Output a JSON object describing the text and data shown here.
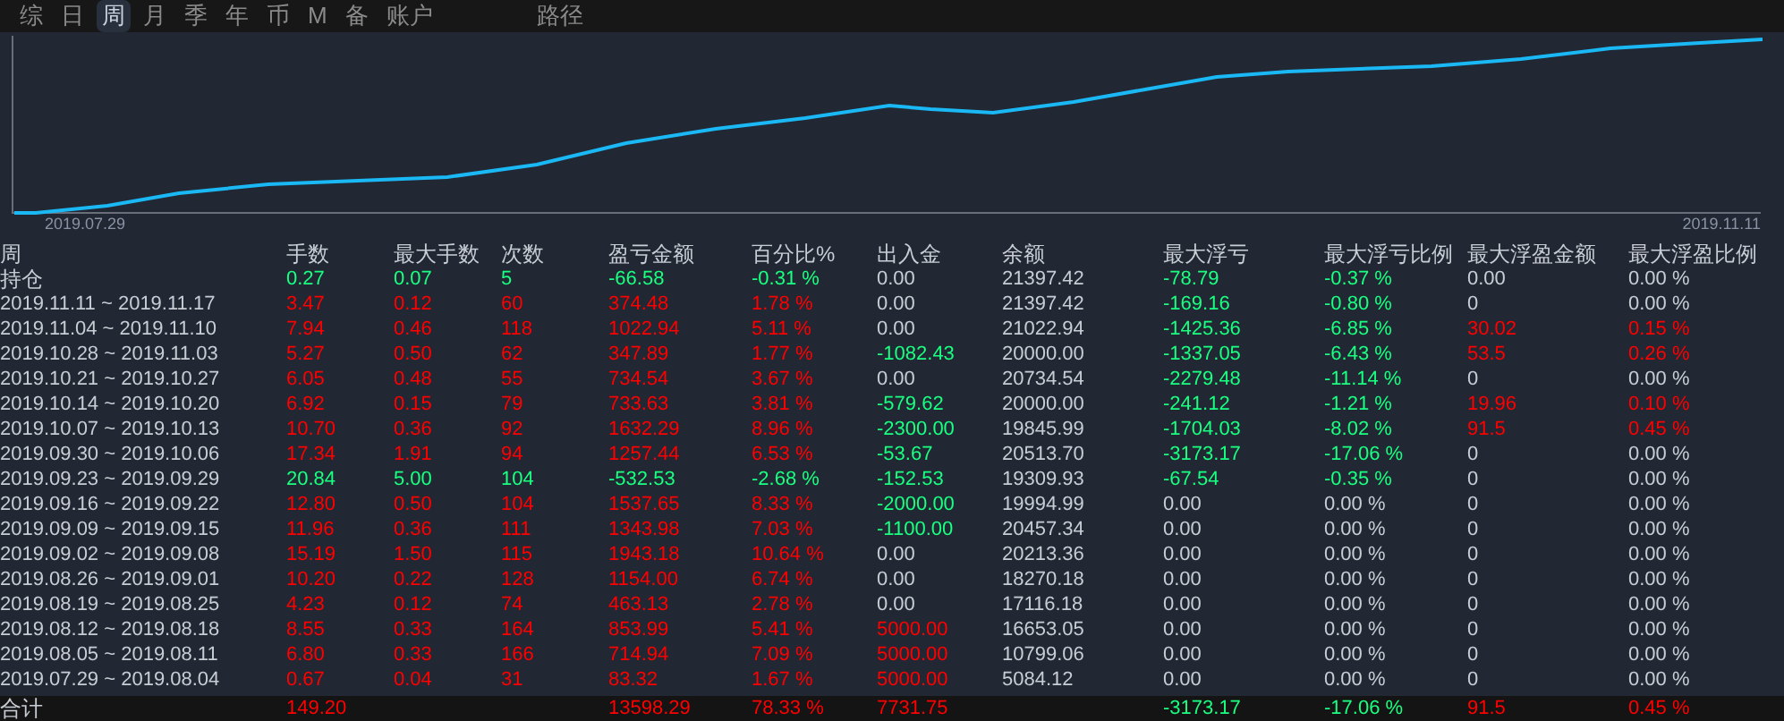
{
  "tabs": [
    {
      "label": "综",
      "selected": false
    },
    {
      "label": "日",
      "selected": false
    },
    {
      "label": "周",
      "selected": true
    },
    {
      "label": "月",
      "selected": false
    },
    {
      "label": "季",
      "selected": false
    },
    {
      "label": "年",
      "selected": false
    },
    {
      "label": "币",
      "selected": false
    },
    {
      "label": "M",
      "selected": false
    },
    {
      "label": "备",
      "selected": false
    },
    {
      "label": "账户",
      "selected": false
    }
  ],
  "right_tabs": [
    {
      "label": "路径",
      "selected": false
    }
  ],
  "chart": {
    "x_start": "2019.07.29",
    "x_end": "2019.11.11"
  },
  "table": {
    "label_header": "周",
    "columns": [
      "手数",
      "最大手数",
      "次数",
      "盈亏金额",
      "百分比%",
      "出入金",
      "余额",
      "最大浮亏",
      "最大浮亏比例",
      "最大浮盈金额",
      "最大浮盈比例"
    ],
    "rows": [
      {
        "label": "持仓",
        "cells": [
          {
            "text": "0.27",
            "color": "#19ff80"
          },
          {
            "text": "0.07",
            "color": "#19ff80"
          },
          {
            "text": "5",
            "color": "#19ff80"
          },
          {
            "text": "-66.58",
            "color": "#19ff80"
          },
          {
            "text": "-0.31 %",
            "color": "#19ff80"
          },
          {
            "text": "0.00",
            "color": "#c8ccd4"
          },
          {
            "text": "21397.42",
            "color": "#c8ccd4"
          },
          {
            "text": "-78.79",
            "color": "#19ff80"
          },
          {
            "text": "-0.37 %",
            "color": "#19ff80"
          },
          {
            "text": "0.00",
            "color": "#c8ccd4"
          },
          {
            "text": "0.00 %",
            "color": "#c8ccd4"
          }
        ]
      },
      {
        "label": "2019.11.11 ~ 2019.11.17",
        "cells": [
          {
            "text": "3.47",
            "color": "#ff0000"
          },
          {
            "text": "0.12",
            "color": "#ff0000"
          },
          {
            "text": "60",
            "color": "#ff0000"
          },
          {
            "text": "374.48",
            "color": "#ff0000"
          },
          {
            "text": "1.78 %",
            "color": "#ff0000"
          },
          {
            "text": "0.00",
            "color": "#c8ccd4"
          },
          {
            "text": "21397.42",
            "color": "#c8ccd4"
          },
          {
            "text": "-169.16",
            "color": "#19ff80"
          },
          {
            "text": "-0.80 %",
            "color": "#19ff80"
          },
          {
            "text": "0",
            "color": "#c8ccd4"
          },
          {
            "text": "0.00 %",
            "color": "#c8ccd4"
          }
        ]
      },
      {
        "label": "2019.11.04 ~ 2019.11.10",
        "cells": [
          {
            "text": "7.94",
            "color": "#ff0000"
          },
          {
            "text": "0.46",
            "color": "#ff0000"
          },
          {
            "text": "118",
            "color": "#ff0000"
          },
          {
            "text": "1022.94",
            "color": "#ff0000"
          },
          {
            "text": "5.11 %",
            "color": "#ff0000"
          },
          {
            "text": "0.00",
            "color": "#c8ccd4"
          },
          {
            "text": "21022.94",
            "color": "#c8ccd4"
          },
          {
            "text": "-1425.36",
            "color": "#19ff80"
          },
          {
            "text": "-6.85 %",
            "color": "#19ff80"
          },
          {
            "text": "30.02",
            "color": "#ff0000"
          },
          {
            "text": "0.15 %",
            "color": "#ff0000"
          }
        ]
      },
      {
        "label": "2019.10.28 ~ 2019.11.03",
        "cells": [
          {
            "text": "5.27",
            "color": "#ff0000"
          },
          {
            "text": "0.50",
            "color": "#ff0000"
          },
          {
            "text": "62",
            "color": "#ff0000"
          },
          {
            "text": "347.89",
            "color": "#ff0000"
          },
          {
            "text": "1.77 %",
            "color": "#ff0000"
          },
          {
            "text": "-1082.43",
            "color": "#19ff80"
          },
          {
            "text": "20000.00",
            "color": "#c8ccd4"
          },
          {
            "text": "-1337.05",
            "color": "#19ff80"
          },
          {
            "text": "-6.43 %",
            "color": "#19ff80"
          },
          {
            "text": "53.5",
            "color": "#ff0000"
          },
          {
            "text": "0.26 %",
            "color": "#ff0000"
          }
        ]
      },
      {
        "label": "2019.10.21 ~ 2019.10.27",
        "cells": [
          {
            "text": "6.05",
            "color": "#ff0000"
          },
          {
            "text": "0.48",
            "color": "#ff0000"
          },
          {
            "text": "55",
            "color": "#ff0000"
          },
          {
            "text": "734.54",
            "color": "#ff0000"
          },
          {
            "text": "3.67 %",
            "color": "#ff0000"
          },
          {
            "text": "0.00",
            "color": "#c8ccd4"
          },
          {
            "text": "20734.54",
            "color": "#c8ccd4"
          },
          {
            "text": "-2279.48",
            "color": "#19ff80"
          },
          {
            "text": "-11.14 %",
            "color": "#19ff80"
          },
          {
            "text": "0",
            "color": "#c8ccd4"
          },
          {
            "text": "0.00 %",
            "color": "#c8ccd4"
          }
        ]
      },
      {
        "label": "2019.10.14 ~ 2019.10.20",
        "cells": [
          {
            "text": "6.92",
            "color": "#ff0000"
          },
          {
            "text": "0.15",
            "color": "#ff0000"
          },
          {
            "text": "79",
            "color": "#ff0000"
          },
          {
            "text": "733.63",
            "color": "#ff0000"
          },
          {
            "text": "3.81 %",
            "color": "#ff0000"
          },
          {
            "text": "-579.62",
            "color": "#19ff80"
          },
          {
            "text": "20000.00",
            "color": "#c8ccd4"
          },
          {
            "text": "-241.12",
            "color": "#19ff80"
          },
          {
            "text": "-1.21 %",
            "color": "#19ff80"
          },
          {
            "text": "19.96",
            "color": "#ff0000"
          },
          {
            "text": "0.10 %",
            "color": "#ff0000"
          }
        ]
      },
      {
        "label": "2019.10.07 ~ 2019.10.13",
        "cells": [
          {
            "text": "10.70",
            "color": "#ff0000"
          },
          {
            "text": "0.36",
            "color": "#ff0000"
          },
          {
            "text": "92",
            "color": "#ff0000"
          },
          {
            "text": "1632.29",
            "color": "#ff0000"
          },
          {
            "text": "8.96 %",
            "color": "#ff0000"
          },
          {
            "text": "-2300.00",
            "color": "#19ff80"
          },
          {
            "text": "19845.99",
            "color": "#c8ccd4"
          },
          {
            "text": "-1704.03",
            "color": "#19ff80"
          },
          {
            "text": "-8.02 %",
            "color": "#19ff80"
          },
          {
            "text": "91.5",
            "color": "#ff0000"
          },
          {
            "text": "0.45 %",
            "color": "#ff0000"
          }
        ]
      },
      {
        "label": "2019.09.30 ~ 2019.10.06",
        "cells": [
          {
            "text": "17.34",
            "color": "#ff0000"
          },
          {
            "text": "1.91",
            "color": "#ff0000"
          },
          {
            "text": "94",
            "color": "#ff0000"
          },
          {
            "text": "1257.44",
            "color": "#ff0000"
          },
          {
            "text": "6.53 %",
            "color": "#ff0000"
          },
          {
            "text": "-53.67",
            "color": "#19ff80"
          },
          {
            "text": "20513.70",
            "color": "#c8ccd4"
          },
          {
            "text": "-3173.17",
            "color": "#19ff80"
          },
          {
            "text": "-17.06 %",
            "color": "#19ff80"
          },
          {
            "text": "0",
            "color": "#c8ccd4"
          },
          {
            "text": "0.00 %",
            "color": "#c8ccd4"
          }
        ]
      },
      {
        "label": "2019.09.23 ~ 2019.09.29",
        "cells": [
          {
            "text": "20.84",
            "color": "#19ff80"
          },
          {
            "text": "5.00",
            "color": "#19ff80"
          },
          {
            "text": "104",
            "color": "#19ff80"
          },
          {
            "text": "-532.53",
            "color": "#19ff80"
          },
          {
            "text": "-2.68 %",
            "color": "#19ff80"
          },
          {
            "text": "-152.53",
            "color": "#19ff80"
          },
          {
            "text": "19309.93",
            "color": "#c8ccd4"
          },
          {
            "text": "-67.54",
            "color": "#19ff80"
          },
          {
            "text": "-0.35 %",
            "color": "#19ff80"
          },
          {
            "text": "0",
            "color": "#c8ccd4"
          },
          {
            "text": "0.00 %",
            "color": "#c8ccd4"
          }
        ]
      },
      {
        "label": "2019.09.16 ~ 2019.09.22",
        "cells": [
          {
            "text": "12.80",
            "color": "#ff0000"
          },
          {
            "text": "0.50",
            "color": "#ff0000"
          },
          {
            "text": "104",
            "color": "#ff0000"
          },
          {
            "text": "1537.65",
            "color": "#ff0000"
          },
          {
            "text": "8.33 %",
            "color": "#ff0000"
          },
          {
            "text": "-2000.00",
            "color": "#19ff80"
          },
          {
            "text": "19994.99",
            "color": "#c8ccd4"
          },
          {
            "text": "0.00",
            "color": "#c8ccd4"
          },
          {
            "text": "0.00 %",
            "color": "#c8ccd4"
          },
          {
            "text": "0",
            "color": "#c8ccd4"
          },
          {
            "text": "0.00 %",
            "color": "#c8ccd4"
          }
        ]
      },
      {
        "label": "2019.09.09 ~ 2019.09.15",
        "cells": [
          {
            "text": "11.96",
            "color": "#ff0000"
          },
          {
            "text": "0.36",
            "color": "#ff0000"
          },
          {
            "text": "111",
            "color": "#ff0000"
          },
          {
            "text": "1343.98",
            "color": "#ff0000"
          },
          {
            "text": "7.03 %",
            "color": "#ff0000"
          },
          {
            "text": "-1100.00",
            "color": "#19ff80"
          },
          {
            "text": "20457.34",
            "color": "#c8ccd4"
          },
          {
            "text": "0.00",
            "color": "#c8ccd4"
          },
          {
            "text": "0.00 %",
            "color": "#c8ccd4"
          },
          {
            "text": "0",
            "color": "#c8ccd4"
          },
          {
            "text": "0.00 %",
            "color": "#c8ccd4"
          }
        ]
      },
      {
        "label": "2019.09.02 ~ 2019.09.08",
        "cells": [
          {
            "text": "15.19",
            "color": "#ff0000"
          },
          {
            "text": "1.50",
            "color": "#ff0000"
          },
          {
            "text": "115",
            "color": "#ff0000"
          },
          {
            "text": "1943.18",
            "color": "#ff0000"
          },
          {
            "text": "10.64 %",
            "color": "#ff0000"
          },
          {
            "text": "0.00",
            "color": "#c8ccd4"
          },
          {
            "text": "20213.36",
            "color": "#c8ccd4"
          },
          {
            "text": "0.00",
            "color": "#c8ccd4"
          },
          {
            "text": "0.00 %",
            "color": "#c8ccd4"
          },
          {
            "text": "0",
            "color": "#c8ccd4"
          },
          {
            "text": "0.00 %",
            "color": "#c8ccd4"
          }
        ]
      },
      {
        "label": "2019.08.26 ~ 2019.09.01",
        "cells": [
          {
            "text": "10.20",
            "color": "#ff0000"
          },
          {
            "text": "0.22",
            "color": "#ff0000"
          },
          {
            "text": "128",
            "color": "#ff0000"
          },
          {
            "text": "1154.00",
            "color": "#ff0000"
          },
          {
            "text": "6.74 %",
            "color": "#ff0000"
          },
          {
            "text": "0.00",
            "color": "#c8ccd4"
          },
          {
            "text": "18270.18",
            "color": "#c8ccd4"
          },
          {
            "text": "0.00",
            "color": "#c8ccd4"
          },
          {
            "text": "0.00 %",
            "color": "#c8ccd4"
          },
          {
            "text": "0",
            "color": "#c8ccd4"
          },
          {
            "text": "0.00 %",
            "color": "#c8ccd4"
          }
        ]
      },
      {
        "label": "2019.08.19 ~ 2019.08.25",
        "cells": [
          {
            "text": "4.23",
            "color": "#ff0000"
          },
          {
            "text": "0.12",
            "color": "#ff0000"
          },
          {
            "text": "74",
            "color": "#ff0000"
          },
          {
            "text": "463.13",
            "color": "#ff0000"
          },
          {
            "text": "2.78 %",
            "color": "#ff0000"
          },
          {
            "text": "0.00",
            "color": "#c8ccd4"
          },
          {
            "text": "17116.18",
            "color": "#c8ccd4"
          },
          {
            "text": "0.00",
            "color": "#c8ccd4"
          },
          {
            "text": "0.00 %",
            "color": "#c8ccd4"
          },
          {
            "text": "0",
            "color": "#c8ccd4"
          },
          {
            "text": "0.00 %",
            "color": "#c8ccd4"
          }
        ]
      },
      {
        "label": "2019.08.12 ~ 2019.08.18",
        "cells": [
          {
            "text": "8.55",
            "color": "#ff0000"
          },
          {
            "text": "0.33",
            "color": "#ff0000"
          },
          {
            "text": "164",
            "color": "#ff0000"
          },
          {
            "text": "853.99",
            "color": "#ff0000"
          },
          {
            "text": "5.41 %",
            "color": "#ff0000"
          },
          {
            "text": "5000.00",
            "color": "#ff0000"
          },
          {
            "text": "16653.05",
            "color": "#c8ccd4"
          },
          {
            "text": "0.00",
            "color": "#c8ccd4"
          },
          {
            "text": "0.00 %",
            "color": "#c8ccd4"
          },
          {
            "text": "0",
            "color": "#c8ccd4"
          },
          {
            "text": "0.00 %",
            "color": "#c8ccd4"
          }
        ]
      },
      {
        "label": "2019.08.05 ~ 2019.08.11",
        "cells": [
          {
            "text": "6.80",
            "color": "#ff0000"
          },
          {
            "text": "0.33",
            "color": "#ff0000"
          },
          {
            "text": "166",
            "color": "#ff0000"
          },
          {
            "text": "714.94",
            "color": "#ff0000"
          },
          {
            "text": "7.09 %",
            "color": "#ff0000"
          },
          {
            "text": "5000.00",
            "color": "#ff0000"
          },
          {
            "text": "10799.06",
            "color": "#c8ccd4"
          },
          {
            "text": "0.00",
            "color": "#c8ccd4"
          },
          {
            "text": "0.00 %",
            "color": "#c8ccd4"
          },
          {
            "text": "0",
            "color": "#c8ccd4"
          },
          {
            "text": "0.00 %",
            "color": "#c8ccd4"
          }
        ]
      },
      {
        "label": "2019.07.29 ~ 2019.08.04",
        "cells": [
          {
            "text": "0.67",
            "color": "#ff0000"
          },
          {
            "text": "0.04",
            "color": "#ff0000"
          },
          {
            "text": "31",
            "color": "#ff0000"
          },
          {
            "text": "83.32",
            "color": "#ff0000"
          },
          {
            "text": "1.67 %",
            "color": "#ff0000"
          },
          {
            "text": "5000.00",
            "color": "#ff0000"
          },
          {
            "text": "5084.12",
            "color": "#c8ccd4"
          },
          {
            "text": "0.00",
            "color": "#c8ccd4"
          },
          {
            "text": "0.00 %",
            "color": "#c8ccd4"
          },
          {
            "text": "0",
            "color": "#c8ccd4"
          },
          {
            "text": "0.00 %",
            "color": "#c8ccd4"
          }
        ]
      }
    ],
    "total": {
      "label": "合计",
      "cells": [
        {
          "text": "149.20",
          "color": "#ff0000"
        },
        null,
        null,
        {
          "text": "13598.29",
          "color": "#ff0000"
        },
        {
          "text": "78.33 %",
          "color": "#ff0000"
        },
        {
          "text": "7731.75",
          "color": "#ff0000"
        },
        null,
        {
          "text": "-3173.17",
          "color": "#19ff80"
        },
        {
          "text": "-17.06 %",
          "color": "#19ff80"
        },
        {
          "text": "91.5",
          "color": "#ff0000"
        },
        {
          "text": "0.45 %",
          "color": "#ff0000"
        }
      ]
    }
  }
}
